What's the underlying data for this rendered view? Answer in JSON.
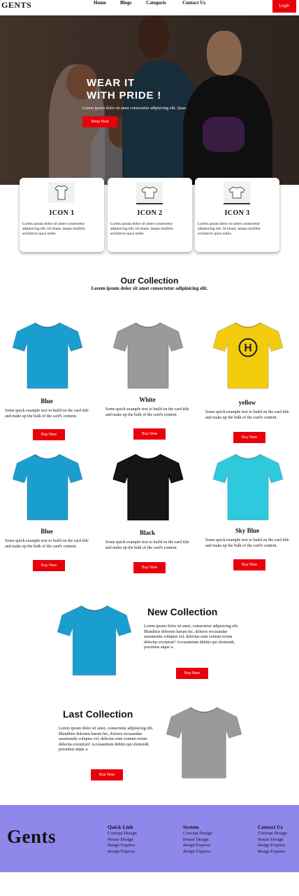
{
  "header": {
    "brand": "GENTS",
    "nav": [
      "Home",
      "Blogs",
      "Categoris",
      "Contact Us"
    ],
    "login_label": "Login",
    "accent_color": "#e8000a"
  },
  "hero": {
    "title_line1": "WEAR IT",
    "title_line2": "WITH PRIDE !",
    "text": "Lorem ipsum dolor sit amet consectetur adipisicing elit. Quae.",
    "button_label": "Shop Now"
  },
  "features": [
    {
      "title": "ICON 1",
      "icon": "tshirt-icon",
      "text": "Lorem ipsum dolor sit amet consectetur adipisicing elit. Id totam, neque mollitia architecto quos nobis."
    },
    {
      "title": "ICON 2",
      "icon": "tshirt-icon",
      "text": "Lorem ipsum dolor sit amet consectetur adipisicing elit. Id totam, neque mollitia architecto quos nobis."
    },
    {
      "title": "ICON 3",
      "icon": "tshirt-icon",
      "text": "Lorem ipsum dolor sit amet consectetur adipisicing elit. Id totam, neque mollitia architecto quos nobis."
    }
  ],
  "collection": {
    "title": "Our Collection",
    "subtitle": "Lorem ipsum dolor sit amet consectetur adipinicing elit.",
    "products": [
      {
        "name": "Blue",
        "color": "#1a9ecf",
        "text": "Some quick example text to build on the card title and make up the bulk of the card's content.",
        "button": "Buy Now"
      },
      {
        "name": "White",
        "color": "#9a9a9a",
        "text": "Some quick example text to build on the card title and make up the bulk of the card's content.",
        "button": "Buy Now"
      },
      {
        "name": "yellow",
        "color": "#f2cc0c",
        "text": "Some quick example text to build on the card title and make up the bulk of the card's content.",
        "button": "Buy Now"
      },
      {
        "name": "Blue",
        "color": "#1a9ecf",
        "text": "Some quick example text to build on the card title and make up the bulk of the card's content.",
        "button": "Buy Now"
      },
      {
        "name": "Black",
        "color": "#151515",
        "text": "Some quick example text to build on the card title and make up the bulk of the card's content.",
        "button": "Buy Now"
      },
      {
        "name": "Sky Blue",
        "color": "#2ec9dc",
        "text": "Some quick example text to build on the card title and make up the bulk of the card's content.",
        "button": "Buy Now"
      }
    ]
  },
  "new_collection": {
    "title": "New Collection",
    "text": "Lorem ipsum dolor sit amet, consectetur adipisicing elit. Blanditiis dolorem harum hic, dolores recusandae assumenda voluptas vel, delectus eum veniam rerum delectus excepturi! Accusantium debitis qui eleniendi, possimus atque a.",
    "button": "Buy Now",
    "shirt_color": "#1a9ecf"
  },
  "last_collection": {
    "title": "Last Collection",
    "text": "Lorem ipsum dolor sit amet, consectetur adipisicing elit. Blanditiis dolorem harum hic, dolores recusandae assumenda voluptas vel, delectus eum veniam rerum delectus excepturi! Accusantium debitis qui eleniendi, possimus atque a.",
    "button": "Buy Now",
    "shirt_color": "#9a9a9a"
  },
  "footer": {
    "brand": "Gents",
    "background": "#8f88ea",
    "columns": [
      {
        "title": "Quick Link",
        "items": [
          "Concept Design",
          "House Design",
          "design Express",
          "design Express"
        ]
      },
      {
        "title": "System",
        "items": [
          "Concept Design",
          "House Design",
          "design Express",
          "design Express"
        ]
      },
      {
        "title": "Contact Us",
        "items": [
          "Concept Design",
          "House Design",
          "design Express",
          "design Express"
        ]
      }
    ]
  }
}
